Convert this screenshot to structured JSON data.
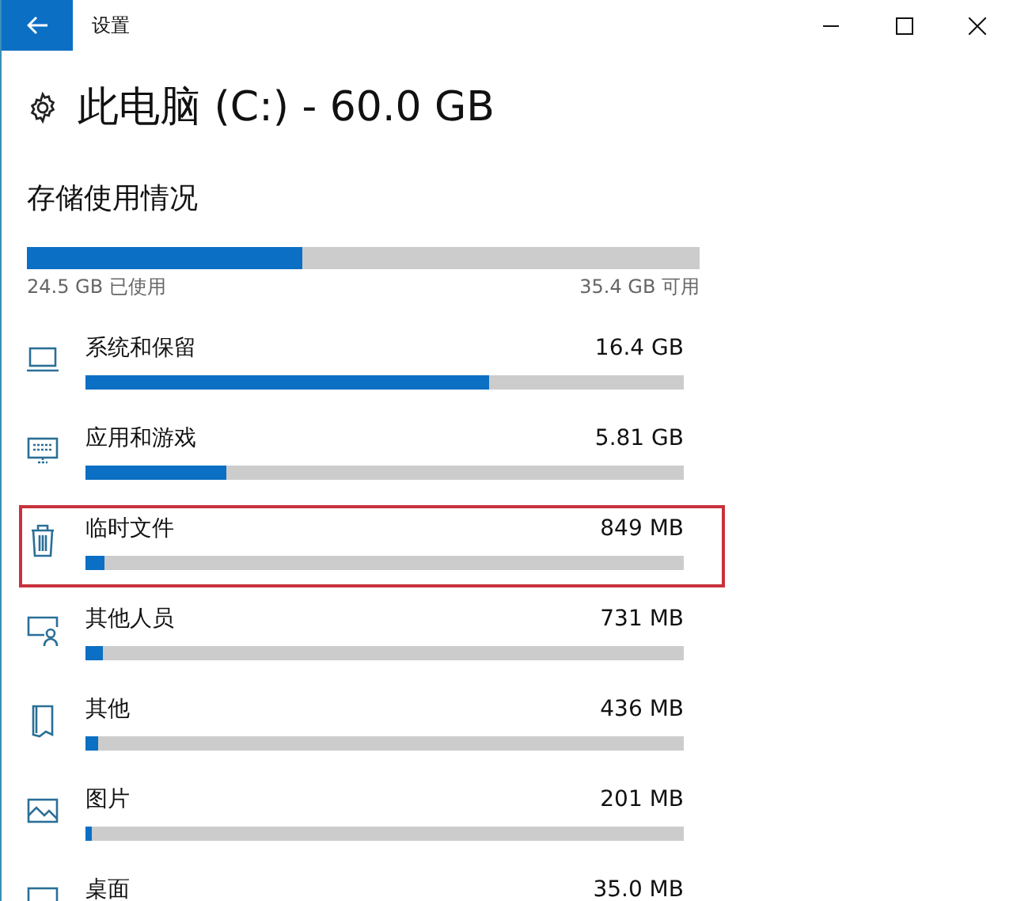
{
  "window": {
    "title": "设置"
  },
  "heading": "此电脑 (C:) - 60.0 GB",
  "section_title": "存储使用情况",
  "usage": {
    "level": 0.41,
    "used": "24.5 GB 已使用",
    "free": "35.4 GB 可用"
  },
  "items": [
    {
      "kind": "system",
      "label": "系统和保留",
      "size": "16.4 GB",
      "level": 0.675,
      "highlighted": false
    },
    {
      "kind": "apps",
      "label": "应用和游戏",
      "size": "5.81 GB",
      "level": 0.235,
      "highlighted": false
    },
    {
      "kind": "temp",
      "label": "临时文件",
      "size": "849 MB",
      "level": 0.032,
      "highlighted": true
    },
    {
      "kind": "people",
      "label": "其他人员",
      "size": "731 MB",
      "level": 0.03,
      "highlighted": false
    },
    {
      "kind": "other",
      "label": "其他",
      "size": "436 MB",
      "level": 0.02,
      "highlighted": false
    },
    {
      "kind": "pictures",
      "label": "图片",
      "size": "201 MB",
      "level": 0.01,
      "highlighted": false
    },
    {
      "kind": "desktop",
      "label": "桌面",
      "size": "35.0 MB",
      "highlighted": false
    }
  ]
}
